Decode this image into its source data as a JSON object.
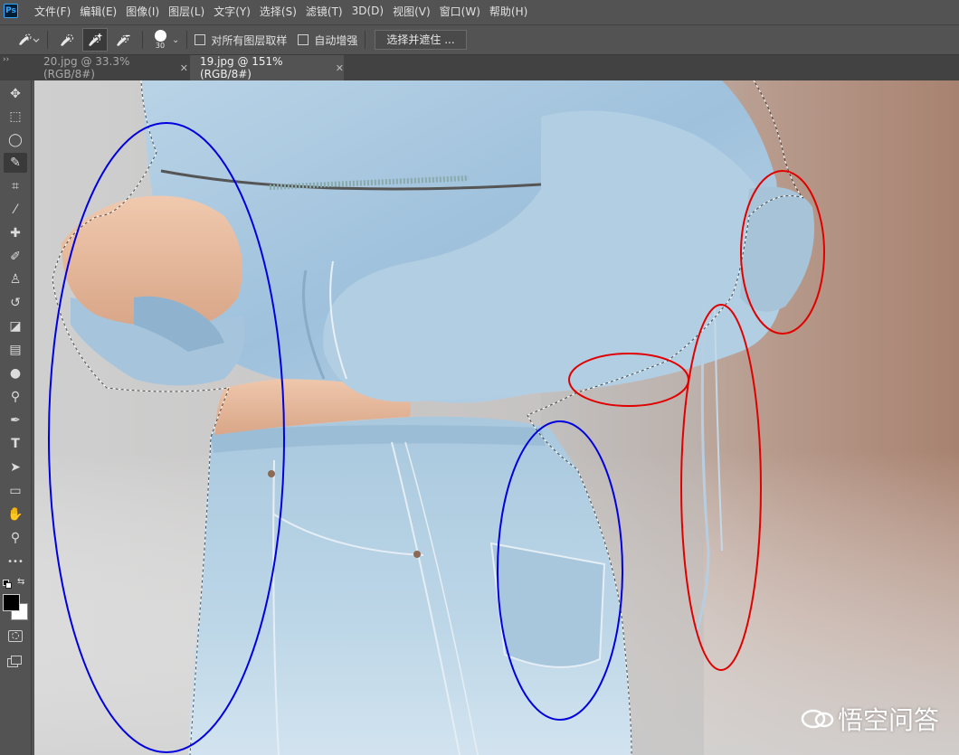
{
  "app": {
    "logo": "Ps"
  },
  "menu": [
    "文件(F)",
    "编辑(E)",
    "图像(I)",
    "图层(L)",
    "文字(Y)",
    "选择(S)",
    "滤镜(T)",
    "3D(D)",
    "视图(V)",
    "窗口(W)",
    "帮助(H)"
  ],
  "options": {
    "brush_size": "30",
    "sample_all_layers_label": "对所有图层取样",
    "auto_enhance_label": "自动增强",
    "select_and_mask_label": "选择并遮住 ..."
  },
  "tabs": [
    {
      "label": "20.jpg @ 33.3%(RGB/8#)",
      "close": "✕",
      "active": false
    },
    {
      "label": "19.jpg @ 151%(RGB/8#)",
      "close": "✕",
      "active": true
    }
  ],
  "tools": [
    {
      "name": "move-tool",
      "glyph": "✥"
    },
    {
      "name": "marquee-tool",
      "glyph": "⬚"
    },
    {
      "name": "lasso-tool",
      "glyph": "◯"
    },
    {
      "name": "quick-selection-tool",
      "glyph": "✎"
    },
    {
      "name": "crop-tool",
      "glyph": "⌗"
    },
    {
      "name": "eyedropper-tool",
      "glyph": "⁄"
    },
    {
      "name": "healing-brush-tool",
      "glyph": "✚"
    },
    {
      "name": "brush-tool",
      "glyph": "✐"
    },
    {
      "name": "clone-stamp-tool",
      "glyph": "♙"
    },
    {
      "name": "history-brush-tool",
      "glyph": "↺"
    },
    {
      "name": "eraser-tool",
      "glyph": "◪"
    },
    {
      "name": "gradient-tool",
      "glyph": "▤"
    },
    {
      "name": "blur-tool",
      "glyph": "●"
    },
    {
      "name": "dodge-tool",
      "glyph": "⚲"
    },
    {
      "name": "pen-tool",
      "glyph": "✒"
    },
    {
      "name": "type-tool",
      "glyph": "T"
    },
    {
      "name": "path-selection-tool",
      "glyph": "➤"
    },
    {
      "name": "rectangle-tool",
      "glyph": "▭"
    },
    {
      "name": "hand-tool",
      "glyph": "✋"
    },
    {
      "name": "zoom-tool",
      "glyph": "⚲"
    },
    {
      "name": "more-tools",
      "glyph": "•••"
    }
  ],
  "colors": {
    "foreground": "#000000",
    "background": "#ffffff",
    "annotation_blue": "#0000e0",
    "annotation_red": "#e00000"
  },
  "watermark": {
    "text": "悟空问答",
    "icon": "speech-bubble-icon"
  }
}
